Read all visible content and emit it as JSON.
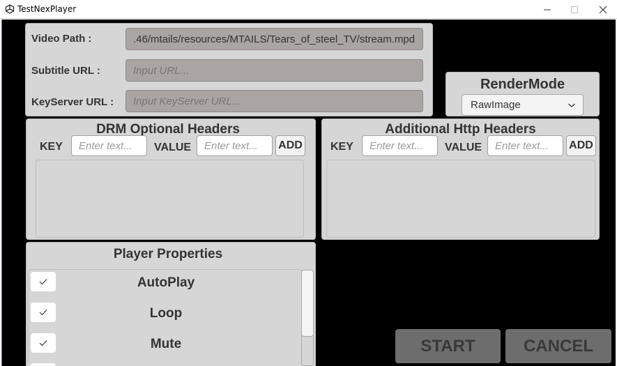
{
  "window": {
    "title": "TestNexPlayer",
    "app_icon": "unity-icon",
    "controls": {
      "minimize": "minimize-icon",
      "maximize": "maximize-icon",
      "close": "close-icon"
    }
  },
  "source_panel": {
    "video_path_label": "Video Path :",
    "video_path_value": ".46/mtails/resources/MTAILS/Tears_of_steel_TV/stream.mpd",
    "subtitle_label": "Subtitle URL :",
    "subtitle_placeholder": "Input URL...",
    "keyserver_label": "KeyServer URL :",
    "keyserver_placeholder": "Input KeyServer URL..."
  },
  "render_mode": {
    "title": "RenderMode",
    "selected": "RawImage"
  },
  "drm_headers": {
    "title": "DRM Optional Headers",
    "key_label": "KEY",
    "key_placeholder": "Enter text...",
    "value_label": "VALUE",
    "value_placeholder": "Enter text...",
    "add_label": "ADD",
    "items": []
  },
  "http_headers": {
    "title": "Additional Http Headers",
    "key_label": "KEY",
    "key_placeholder": "Enter text...",
    "value_label": "VALUE",
    "value_placeholder": "Enter text...",
    "add_label": "ADD",
    "items": []
  },
  "player_properties": {
    "title": "Player Properties",
    "items": [
      {
        "label": "AutoPlay",
        "checked": true
      },
      {
        "label": "Loop",
        "checked": true
      },
      {
        "label": "Mute",
        "checked": true
      }
    ]
  },
  "actions": {
    "start_label": "START",
    "cancel_label": "CANCEL"
  }
}
